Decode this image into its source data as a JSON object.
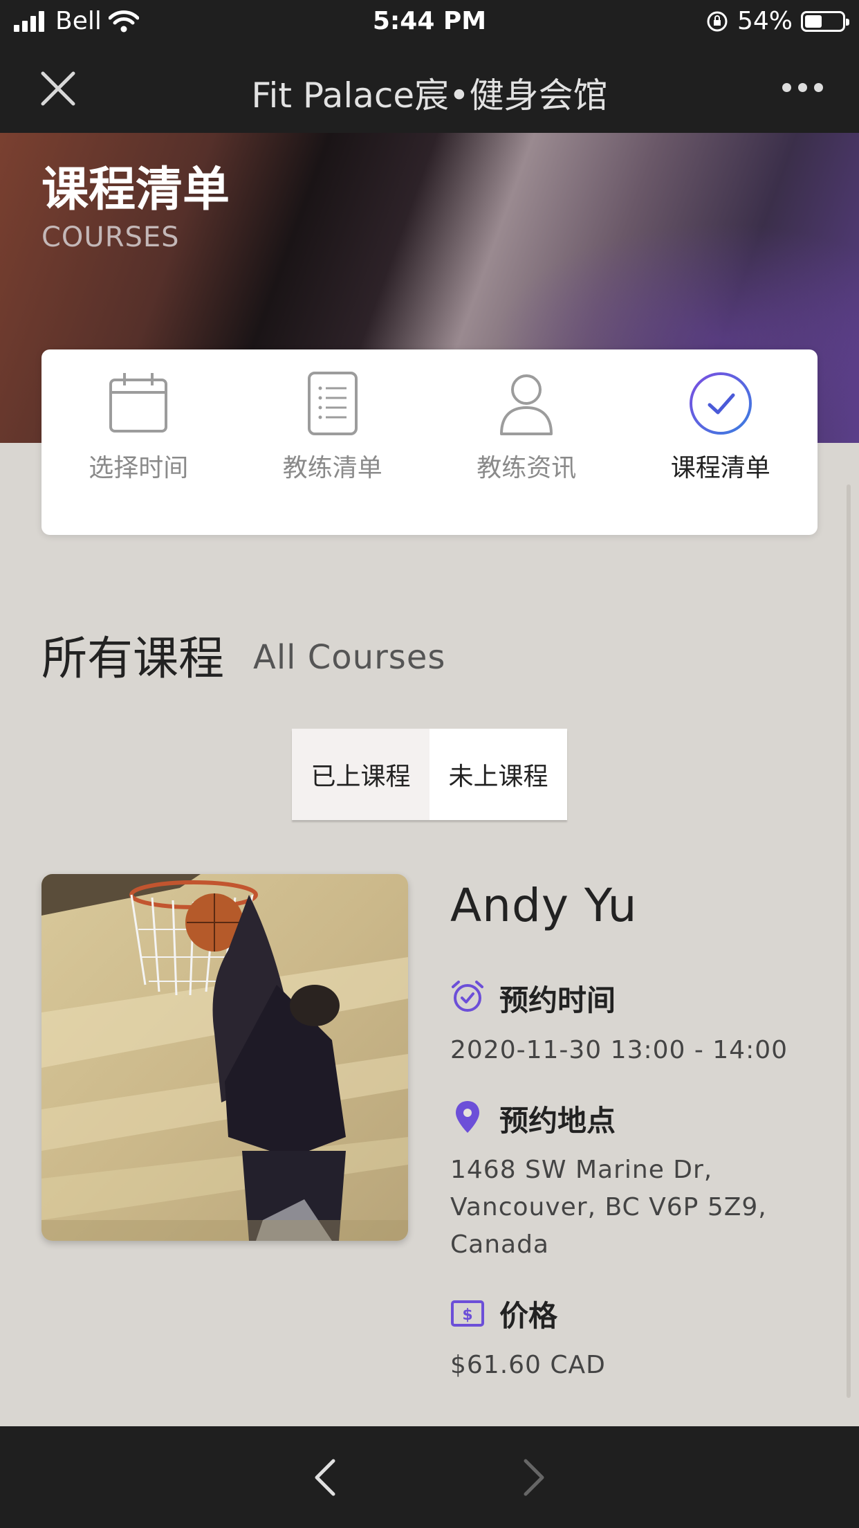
{
  "status": {
    "carrier": "Bell",
    "time": "5:44 PM",
    "battery": "54%"
  },
  "nav": {
    "title": "Fit Palace宸•健身会馆"
  },
  "hero": {
    "title": "课程清单",
    "subtitle": "COURSES"
  },
  "steps": [
    {
      "label": "选择时间",
      "icon": "calendar-icon",
      "active": false
    },
    {
      "label": "教练清单",
      "icon": "list-document-icon",
      "active": false
    },
    {
      "label": "教练资讯",
      "icon": "user-icon",
      "active": false
    },
    {
      "label": "课程清单",
      "icon": "check-circle-icon",
      "active": true
    }
  ],
  "section": {
    "title": "所有课程",
    "subtitle": "All Courses"
  },
  "toggle": {
    "past": "已上课程",
    "upcoming": "未上课程",
    "selected": "past"
  },
  "course": {
    "coach": "Andy Yu",
    "time_label": "预约时间",
    "time_value": "2020-11-30 13:00 - 14:00",
    "location_label": "预约地点",
    "location_line1": "1468 SW Marine Dr,",
    "location_line2": "Vancouver, BC V6P 5Z9,",
    "location_line3": "Canada",
    "price_label": "价格",
    "price_value": "$61.60 CAD"
  },
  "colors": {
    "accent": "#6c4fd8",
    "dark_bar": "#1f1f1f"
  }
}
